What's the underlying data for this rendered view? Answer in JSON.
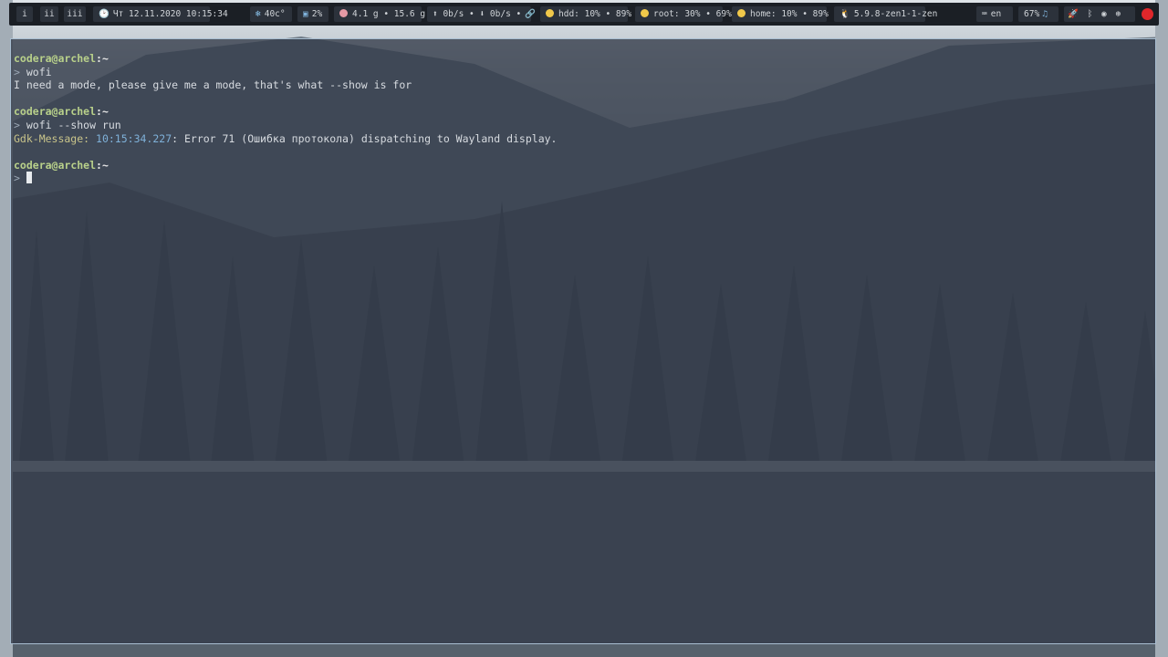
{
  "workspaces": [
    "i",
    "ii",
    "iii"
  ],
  "clock": {
    "icon": "clock-icon",
    "text": "Чт 12.11.2020 10:15:34"
  },
  "status": {
    "temperature": {
      "icon": "snowflake-icon",
      "text": "40c°"
    },
    "cpu": {
      "icon": "monitor-icon",
      "text": "2%"
    },
    "memory": {
      "icon": "brain-icon",
      "text": "4.1 g • 15.6 g"
    },
    "network": {
      "text": "⬆ 0b/s • ⬇ 0b/s •",
      "icon": "link-icon"
    },
    "hdd": {
      "icon": "disk-icon",
      "text": "hdd: 10% • 89%"
    },
    "root": {
      "icon": "disk-icon",
      "text": "root: 30% • 69%"
    },
    "home": {
      "icon": "disk-icon",
      "text": "home: 10% • 89%"
    },
    "kernel": {
      "icon": "tux-icon",
      "text": "5.9.8-zen1-1-zen"
    },
    "layout": {
      "icon": "keyboard-icon",
      "text": "en"
    },
    "volume": {
      "text": "67%",
      "icon": "music-icon"
    },
    "tray": [
      "rocket-icon",
      "bluetooth-icon",
      "discord-icon",
      "steam-icon",
      "record-icon"
    ]
  },
  "terminal": {
    "blocks": [
      {
        "user": "codera",
        "host": "archel",
        "path": "~",
        "command": "wofi",
        "output": "I need a mode, please give me a mode, that's what --show is for"
      },
      {
        "user": "codera",
        "host": "archel",
        "path": "~",
        "command": "wofi --show run",
        "output_prefix": "Gdk-Message:",
        "output_time": "10:15:34.227",
        "output_rest": ": Error 71 (Ошибка протокола) dispatching to Wayland display."
      },
      {
        "user": "codera",
        "host": "archel",
        "path": "~"
      }
    ],
    "prompt_symbol": ">"
  },
  "colors": {
    "bar_bg": "#1b1f25",
    "module_bg": "#2c323b",
    "accent_green": "#b8d08a",
    "timestamp_blue": "#7fb1d9",
    "record_red": "#e0272b"
  }
}
